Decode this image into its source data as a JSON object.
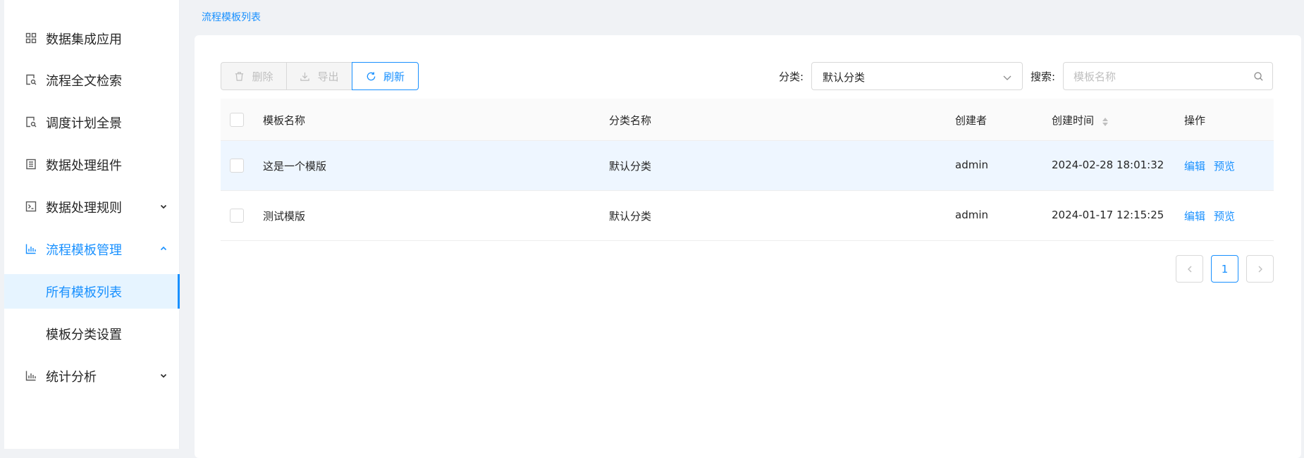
{
  "sidebar": {
    "items": [
      {
        "label": "数据集成应用",
        "icon": "grid-icon"
      },
      {
        "label": "流程全文检索",
        "icon": "doc-search-icon"
      },
      {
        "label": "调度计划全景",
        "icon": "doc-search-icon"
      },
      {
        "label": "数据处理组件",
        "icon": "list-doc-icon"
      },
      {
        "label": "数据处理规则",
        "icon": "terminal-icon"
      },
      {
        "label": "流程模板管理",
        "icon": "bar-chart-icon"
      },
      {
        "label": "统计分析",
        "icon": "bar-chart-icon"
      }
    ],
    "submenu": [
      {
        "label": "所有模板列表"
      },
      {
        "label": "模板分类设置"
      }
    ]
  },
  "breadcrumb": "流程模板列表",
  "toolbar": {
    "delete_label": "删除",
    "export_label": "导出",
    "refresh_label": "刷新",
    "category_label": "分类:",
    "category_value": "默认分类",
    "search_label": "搜索:",
    "search_placeholder": "模板名称"
  },
  "table": {
    "headers": [
      "模板名称",
      "分类名称",
      "创建者",
      "创建时间",
      "操作"
    ],
    "rows": [
      {
        "name": "这是一个模版",
        "category": "默认分类",
        "creator": "admin",
        "created": "2024-02-28 18:01:32",
        "edit": "编辑",
        "preview": "预览"
      },
      {
        "name": "测试模版",
        "category": "默认分类",
        "creator": "admin",
        "created": "2024-01-17 12:15:25",
        "edit": "编辑",
        "preview": "预览"
      }
    ]
  },
  "pagination": {
    "current": "1"
  },
  "colors": {
    "accent": "#1890ff",
    "background": "#f0f2f5",
    "hover_row": "#eef6ff"
  }
}
